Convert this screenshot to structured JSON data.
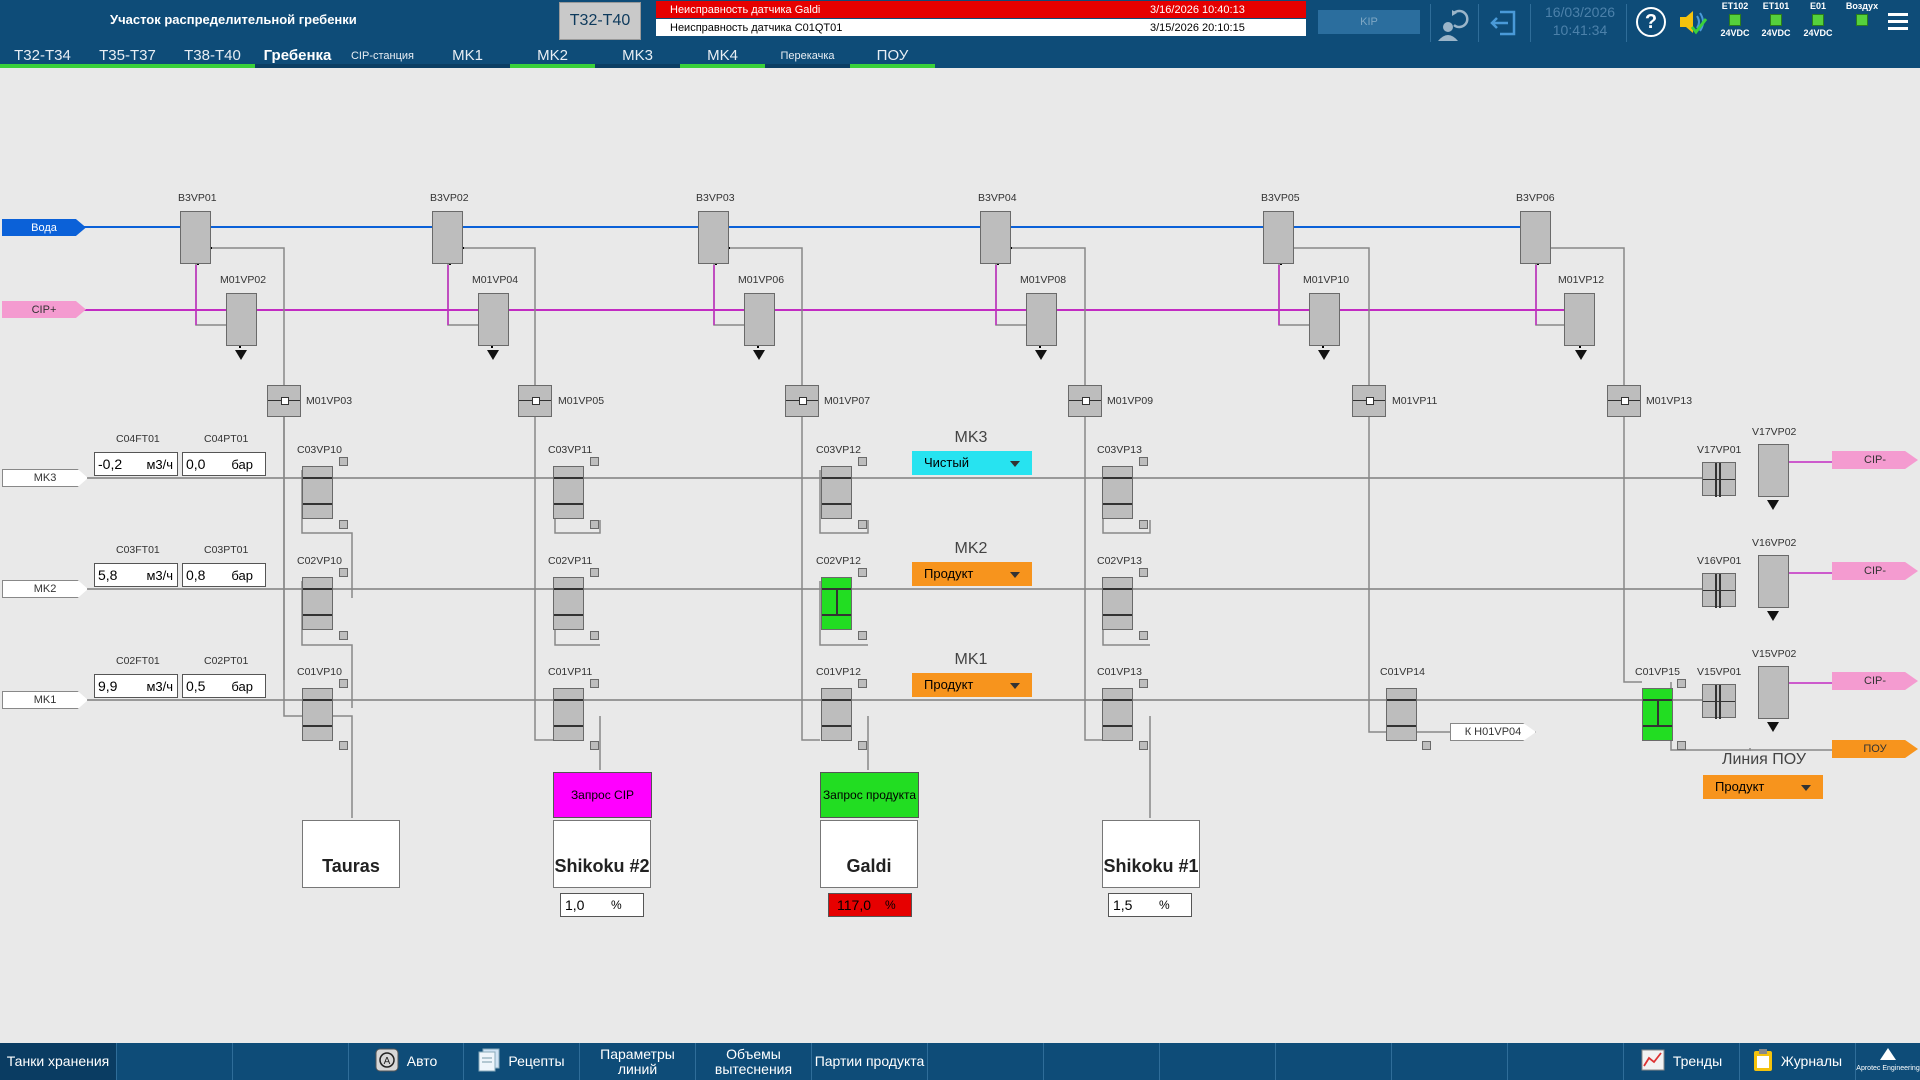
{
  "header": {
    "title": "Участок распределительной гребенки",
    "group_button": "T32-T40",
    "alarms": [
      {
        "text": "Неисправность датчика Galdi",
        "time": "3/16/2026 10:40:13"
      },
      {
        "text": "Неисправность датчика C01QT01",
        "time": "3/15/2026 20:10:15"
      }
    ],
    "kip_label": "KIP",
    "date": "16/03/2026",
    "time": "10:41:34",
    "help_label": "?",
    "psu": [
      {
        "name": "ET102",
        "voltage": "24VDC"
      },
      {
        "name": "ET101",
        "voltage": "24VDC"
      },
      {
        "name": "E01",
        "voltage": "24VDC"
      },
      {
        "name": "Воздух",
        "voltage": ""
      }
    ]
  },
  "tabs": [
    "T32-T34",
    "T35-T37",
    "T38-T40",
    "Гребенка",
    "CIP-станция",
    "MK1",
    "MK2",
    "MK3",
    "MK4",
    "Перекачка",
    "ПОУ"
  ],
  "active_tab": "Гребенка",
  "colors": {
    "header_bg": "#0e4c78",
    "water": "#0b61d8",
    "cip_plus": "#f49bd0",
    "cip_line": "#c22bc2",
    "pou": "#f7941d",
    "valve_open": "#22dd22",
    "dropdown_clean": "#27e3f0",
    "dropdown_product": "#f7941d",
    "request_cip": "#ff00ff",
    "request_product": "#22dd22",
    "alarm_red": "#e60000"
  },
  "sources": {
    "water": "Вода",
    "cip_plus": "CIP+",
    "mk3": "MK3",
    "mk2": "MK2",
    "mk1": "MK1"
  },
  "outputs": {
    "cip_minus": "CIP-",
    "pou": "ПОУ",
    "to_h01vp04": "К H01VP04"
  },
  "valve_tags": {
    "b3": [
      "B3VP01",
      "B3VP02",
      "B3VP03",
      "B3VP04",
      "B3VP05",
      "B3VP06"
    ],
    "m_cip": [
      "M01VP02",
      "M01VP04",
      "M01VP06",
      "M01VP08",
      "M01VP10",
      "M01VP12"
    ],
    "m_mid": [
      "M01VP03",
      "M01VP05",
      "M01VP07",
      "M01VP09",
      "M01VP11",
      "M01VP13"
    ],
    "c03": [
      "C03VP10",
      "C03VP11",
      "C03VP12",
      "C03VP13"
    ],
    "c02": [
      "C02VP10",
      "C02VP11",
      "C02VP12",
      "C02VP13"
    ],
    "c01": [
      "C01VP10",
      "C01VP11",
      "C01VP12",
      "C01VP13",
      "C01VP14",
      "C01VP15"
    ],
    "v_right": [
      "V17VP01",
      "V17VP02",
      "V16VP01",
      "V16VP02",
      "V15VP01",
      "V15VP02"
    ]
  },
  "instruments": [
    {
      "flow_tag": "C04FT01",
      "flow": "-0,2",
      "flow_unit": "м3/ч",
      "press_tag": "C04PT01",
      "press": "0,0",
      "press_unit": "бар"
    },
    {
      "flow_tag": "C03FT01",
      "flow": "5,8",
      "flow_unit": "м3/ч",
      "press_tag": "C03PT01",
      "press": "0,8",
      "press_unit": "бар"
    },
    {
      "flow_tag": "C02FT01",
      "flow": "9,9",
      "flow_unit": "м3/ч",
      "press_tag": "C02PT01",
      "press": "0,5",
      "press_unit": "бар"
    }
  ],
  "mk_modes": [
    {
      "label": "MK3",
      "mode": "Чистый"
    },
    {
      "label": "MK2",
      "mode": "Продукт"
    },
    {
      "label": "MK1",
      "mode": "Продукт"
    }
  ],
  "pou_line": {
    "label": "Линия ПОУ",
    "mode": "Продукт"
  },
  "tanks": [
    {
      "name": "Tauras",
      "request": "",
      "level": "",
      "unit": ""
    },
    {
      "name": "Shikoku #2",
      "request": "Запрос CIP",
      "level": "1,0",
      "unit": "%"
    },
    {
      "name": "Galdi",
      "request": "Запрос продукта",
      "level": "117,0",
      "unit": "%"
    },
    {
      "name": "Shikoku #1",
      "request": "",
      "level": "1,5",
      "unit": "%"
    }
  ],
  "footer": {
    "storage_tanks": "Танки хранения",
    "auto": "Авто",
    "recipes": "Рецепты",
    "line_params": "Параметры линий",
    "displacement_volumes": "Объемы вытеснения",
    "product_batches": "Партии продукта",
    "trends": "Тренды",
    "journals": "Журналы",
    "logo": "Aprotec Engineering"
  }
}
